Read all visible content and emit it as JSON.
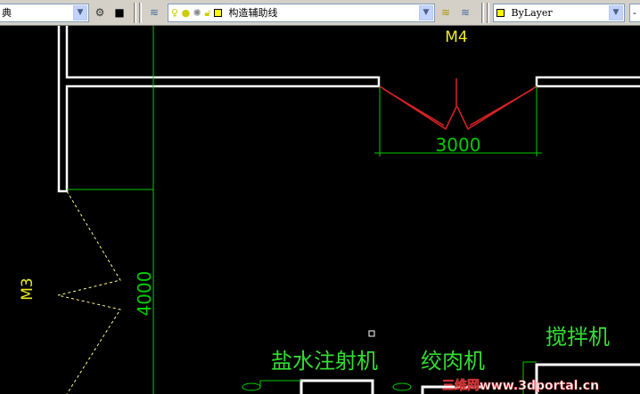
{
  "toolbar": {
    "style_combo": "典",
    "layer_combo": "构造辅助线",
    "color_combo": "ByLayer",
    "colors": {
      "layer_swatch": "#ffff00"
    }
  },
  "drawing": {
    "door_m4": "M4",
    "door_m3": "M3",
    "dim_3000": "3000",
    "dim_4000": "4000",
    "label_saline": "盐水注射机",
    "label_grinder": "绞肉机",
    "label_mixer": "搅拌机"
  },
  "watermark": "三维网www.3dportal.cn"
}
